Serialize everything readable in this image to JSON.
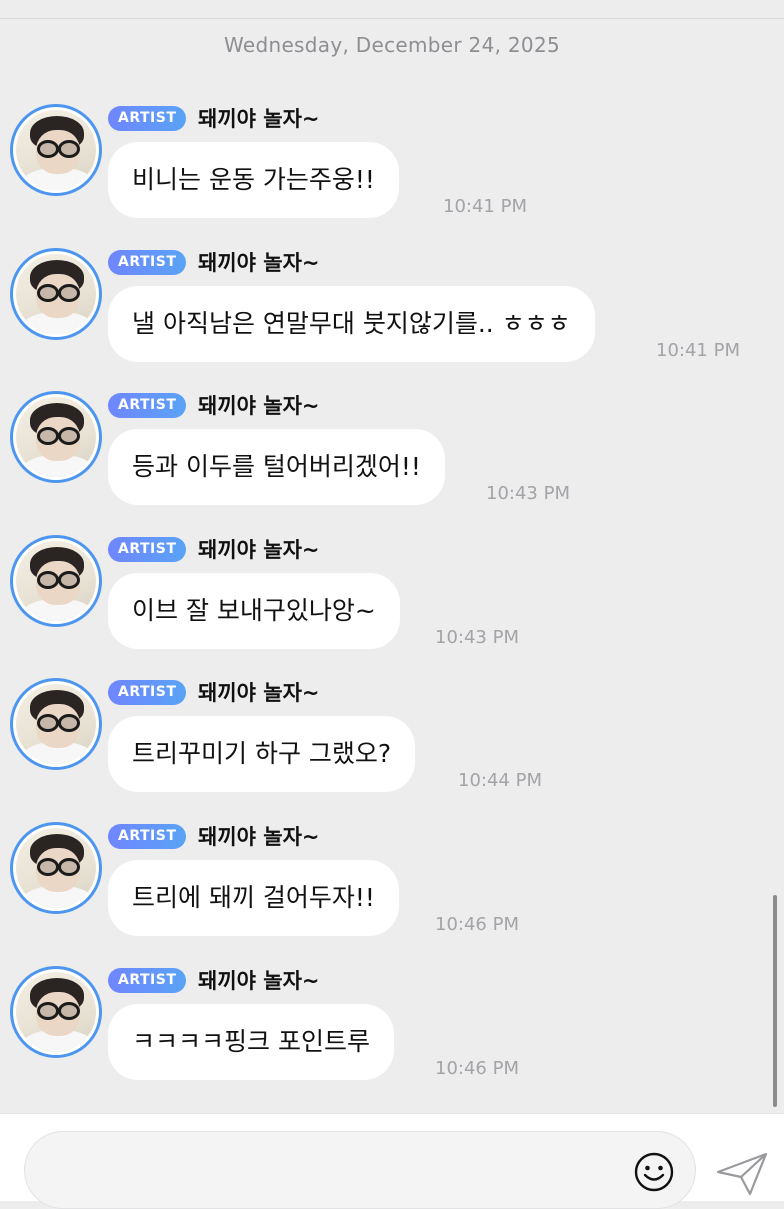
{
  "date_separator": "Wednesday, December 24, 2025",
  "messages": [
    {
      "badge": "ARTIST",
      "sender": "돼끼야 놀자~",
      "text": "비니는 운동 가는주웅!!",
      "time": "10:41 PM"
    },
    {
      "badge": "ARTIST",
      "sender": "돼끼야 놀자~",
      "text": "낼 아직남은 연말무대 붓지않기를.. ㅎㅎㅎ",
      "time": "10:41 PM"
    },
    {
      "badge": "ARTIST",
      "sender": "돼끼야 놀자~",
      "text": "등과 이두를 털어버리겠어!!",
      "time": "10:43 PM"
    },
    {
      "badge": "ARTIST",
      "sender": "돼끼야 놀자~",
      "text": "이브 잘 보내구있나앙~",
      "time": "10:43 PM"
    },
    {
      "badge": "ARTIST",
      "sender": "돼끼야 놀자~",
      "text": "트리꾸미기 하구 그랬오?",
      "time": "10:44 PM"
    },
    {
      "badge": "ARTIST",
      "sender": "돼끼야 놀자~",
      "text": "트리에 돼끼 걸어두자!!",
      "time": "10:46 PM"
    },
    {
      "badge": "ARTIST",
      "sender": "돼끼야 놀자~",
      "text": "ㅋㅋㅋㅋ핑크 포인트루",
      "time": "10:46 PM"
    }
  ],
  "composer": {
    "value": "",
    "placeholder": "",
    "emoji_icon": "smiley-face-icon",
    "send_icon": "paper-plane-icon"
  },
  "colors": {
    "background": "#ededee",
    "bubble": "#ffffff",
    "badge_gradient_start": "#6f86ff",
    "badge_gradient_end": "#5aa3f5",
    "avatar_ring": "#4d96f0"
  }
}
